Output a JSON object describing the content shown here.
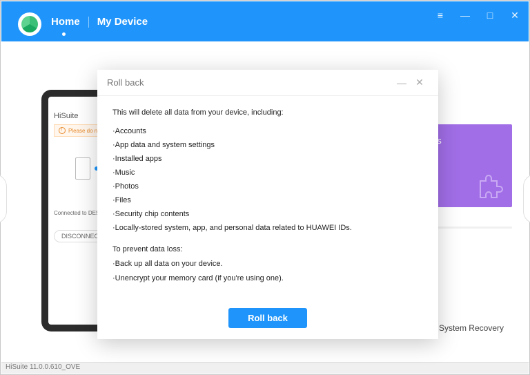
{
  "topbar": {
    "nav_home": "Home",
    "nav_device": "My Device"
  },
  "phone_panel": {
    "title": "HiSuite",
    "warning": "Please do not leave",
    "connected": "Connected to DESKTOP-…",
    "disconnect": "DISCONNECT"
  },
  "right": {
    "card_text": "os",
    "bottom_label": "System Recovery"
  },
  "statusbar": {
    "version": "HiSuite 11.0.0.610_OVE"
  },
  "modal": {
    "title": "Roll back",
    "intro": "This will delete all data from your device, including:",
    "items": [
      "·Accounts",
      "·App data and system settings",
      "·Installed apps",
      "·Music",
      "·Photos",
      "·Files",
      "·Security chip contents",
      "·Locally-stored system, app, and personal data related to HUAWEI IDs."
    ],
    "sub_heading": "To prevent data loss:",
    "sub_items": [
      "·Back up all data on your device.",
      "·Unencrypt your memory card (if you're using one)."
    ],
    "primary_btn": "Roll back"
  }
}
